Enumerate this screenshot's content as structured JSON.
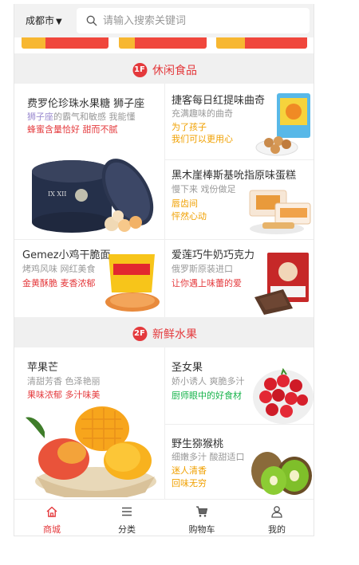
{
  "header": {
    "city": "成都市",
    "city_arrow": "▼",
    "search_placeholder": "请输入搜索关键词"
  },
  "floors": [
    {
      "badge": "1F",
      "title": "休闲食品",
      "items": [
        {
          "name": "费罗伦珍珠水果糖 狮子座",
          "sub_em": "狮子座",
          "sub_rest": "的霸气和敏感  我能懂",
          "tag1": "蜂蜜含量恰好",
          "tag2": "甜而不腻"
        },
        {
          "name": "捷客每日红提味曲奇",
          "sub": "充满趣味的曲奇",
          "tag1": "为了孩子",
          "tag2": "我们可以更用心"
        },
        {
          "name": "黑木崖棒斯基吮指原味蛋糕",
          "sub": "慢下来  戏份做足",
          "tag1": "唇齿间",
          "tag2": "怦然心动"
        },
        {
          "name": "Gemez小鸡干脆面",
          "sub": "烤鸡风味  网红美食",
          "tag1": "金黄酥脆",
          "tag2": "麦香浓郁"
        },
        {
          "name": "爱莲巧牛奶巧克力",
          "sub": "俄罗斯原装进口",
          "tag1": "让你遇上味蕾的爱"
        }
      ]
    },
    {
      "badge": "2F",
      "title": "新鲜水果",
      "items": [
        {
          "name": "苹果芒",
          "sub": "清甜芳香  色泽艳丽",
          "tag1": "果味浓郁",
          "tag2": "多汁味美"
        },
        {
          "name": "圣女果",
          "sub": "娇小诱人  爽脆多汁",
          "tag1": "厨师眼中的好食材"
        },
        {
          "name": "野生猕猴桃",
          "sub": "细嫩多汁  酸甜适口",
          "tag1": "迷人清香",
          "tag2": "回味无穷"
        }
      ]
    }
  ],
  "nav": [
    {
      "label": "商城",
      "icon": "home-icon",
      "active": true
    },
    {
      "label": "分类",
      "icon": "list-icon"
    },
    {
      "label": "购物车",
      "icon": "cart-icon"
    },
    {
      "label": "我的",
      "icon": "user-icon"
    }
  ],
  "colors": {
    "accent": "#e4393c",
    "yellow": "#f7b731",
    "orange_text": "#f0a000",
    "green_text": "#16b34a"
  }
}
